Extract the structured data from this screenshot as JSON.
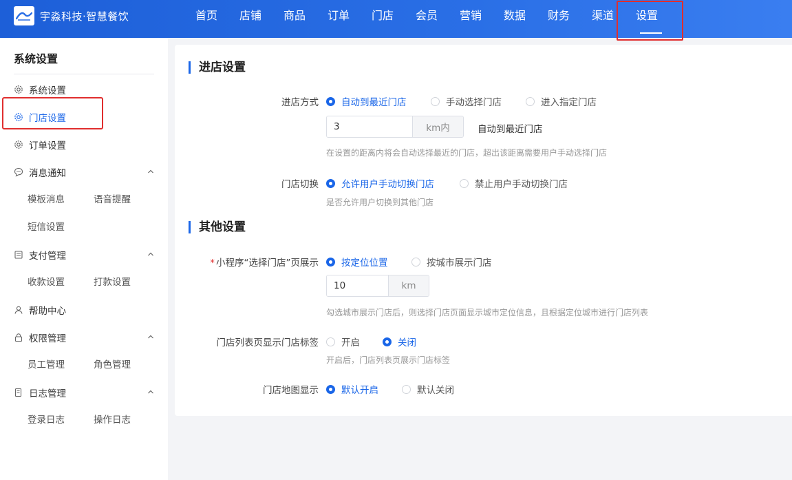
{
  "app": {
    "brand_name": "宇淼科技·智慧餐饮"
  },
  "nav": {
    "items": [
      "首页",
      "店铺",
      "商品",
      "订单",
      "门店",
      "会员",
      "营销",
      "数据",
      "财务",
      "渠道",
      "设置"
    ],
    "active": "设置"
  },
  "sidebar": {
    "title": "系统设置",
    "items": [
      {
        "label": "系统设置",
        "icon": "gear-icon"
      },
      {
        "label": "门店设置",
        "icon": "gear-icon",
        "active": true
      },
      {
        "label": "订单设置",
        "icon": "gear-icon"
      },
      {
        "label": "消息通知",
        "icon": "chat-icon",
        "sub": [
          "模板消息",
          "语音提醒",
          "短信设置"
        ]
      },
      {
        "label": "支付管理",
        "icon": "wallet-icon",
        "sub": [
          "收款设置",
          "打款设置"
        ]
      },
      {
        "label": "帮助中心",
        "icon": "user-icon"
      },
      {
        "label": "权限管理",
        "icon": "lock-icon",
        "sub": [
          "员工管理",
          "角色管理"
        ]
      },
      {
        "label": "日志管理",
        "icon": "log-icon",
        "sub": [
          "登录日志",
          "操作日志"
        ]
      }
    ]
  },
  "sections": {
    "entry": {
      "title": "进店设置",
      "mode": {
        "label": "进店方式",
        "options": [
          "自动到最近门店",
          "手动选择门店",
          "进入指定门店"
        ],
        "selected": "自动到最近门店",
        "distance_value": "3",
        "distance_unit": "km内",
        "after_text": "自动到最近门店",
        "hint": "在设置的距离内将会自动选择最近的门店，超出该距离需要用户手动选择门店"
      },
      "switch": {
        "label": "门店切换",
        "options": [
          "允许用户手动切换门店",
          "禁止用户手动切换门店"
        ],
        "selected": "允许用户手动切换门店",
        "hint": "是否允许用户切换到其他门店"
      }
    },
    "other": {
      "title": "其他设置",
      "mini": {
        "required_mark": "*",
        "label": "小程序“选择门店”页展示",
        "options": [
          "按定位位置",
          "按城市展示门店"
        ],
        "selected": "按定位位置",
        "distance_value": "10",
        "distance_unit": "km",
        "hint": "勾选城市展示门店后，则选择门店页面显示城市定位信息，且根据定位城市进行门店列表"
      },
      "tag": {
        "label": "门店列表页显示门店标签",
        "options": [
          "开启",
          "关闭"
        ],
        "selected": "关闭",
        "hint": "开启后，门店列表页展示门店标签"
      },
      "map": {
        "label": "门店地图显示",
        "options": [
          "默认开启",
          "默认关闭"
        ],
        "selected": "默认开启"
      }
    }
  },
  "colors": {
    "accent": "#1a66e8",
    "header": "#2a6fe6",
    "highlight": "#e02e2e"
  }
}
